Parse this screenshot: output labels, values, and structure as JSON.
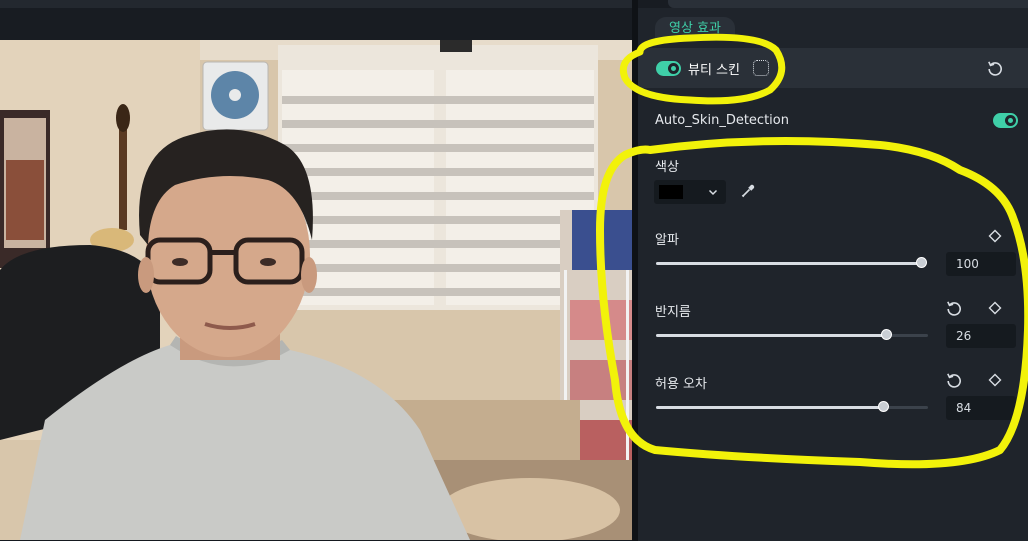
{
  "panel": {
    "section_tab": "영상 효과",
    "effect": {
      "name": "뷰티 스킨",
      "enabled": true,
      "toggle_icon": "toggle-on-icon",
      "mask_icon": "dotted-square-icon",
      "reset_icon": "reset-icon"
    },
    "auto_skin_detection": {
      "label": "Auto_Skin_Detection",
      "enabled": true
    },
    "color": {
      "label": "색상",
      "value": "#000000",
      "dropdown_icon": "chevron-down-icon",
      "eyedropper_icon": "eyedropper-icon"
    },
    "alpha": {
      "label": "알파",
      "value": "100",
      "fraction": 1.0,
      "keyframe_icon": "diamond-icon"
    },
    "radius": {
      "label": "반지름",
      "value": "26",
      "fraction": 0.85,
      "reset_icon": "reset-icon",
      "keyframe_icon": "diamond-icon"
    },
    "tolerance": {
      "label": "허용 오차",
      "value": "84",
      "fraction": 0.84,
      "reset_icon": "reset-icon",
      "keyframe_icon": "diamond-icon"
    }
  },
  "colors": {
    "accent": "#3fcfa8",
    "panel_bg": "#1f242b",
    "annotation": "#f2f20a"
  }
}
